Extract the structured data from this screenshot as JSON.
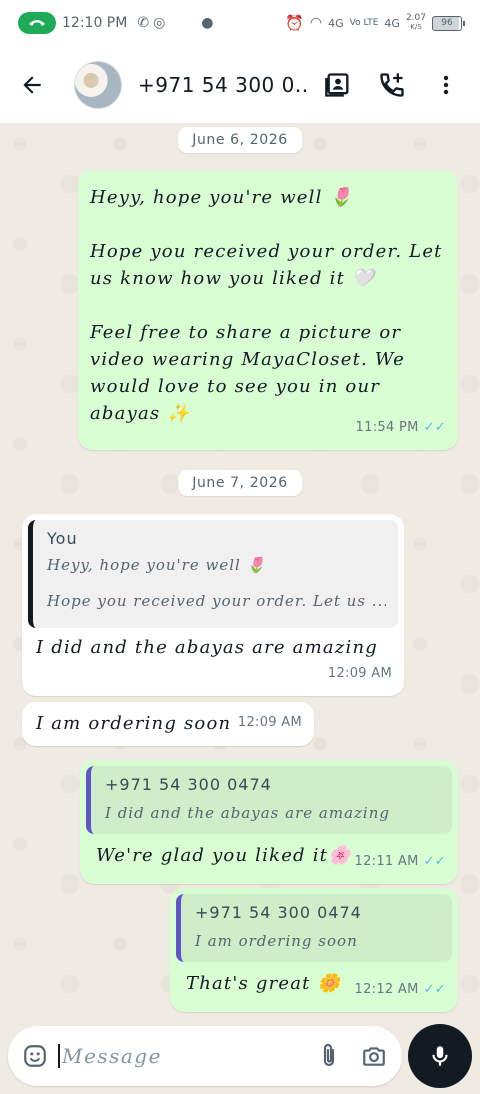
{
  "status_bar": {
    "time": "12:10 PM",
    "net_speed": "2.07",
    "net_unit": "K/S",
    "battery": "96",
    "signal1": "4G",
    "signal2": "Vo LTE",
    "signal3": "4G"
  },
  "header": {
    "contact_name": "+971 54 300 0...",
    "icons": [
      "back-arrow-icon",
      "contact-card-icon",
      "add-call-icon",
      "more-vert-icon"
    ]
  },
  "chat": {
    "date1": "June 6, 2026",
    "msg1": {
      "text": "Heyy, hope you're well 🌷\n\nHope you received your order. Let us know how you liked it 🤍\n\nFeel free to share a picture or video wearing MayaCloset. We would love to see you in our abayas ✨",
      "time": "11:54 PM"
    },
    "date2": "June 7, 2026",
    "msg2": {
      "quote_author": "You",
      "quote_line1": "Heyy, hope you're well 🌷",
      "quote_line2": "Hope you received your order. Let us ...",
      "text": "I did and the abayas are amazing",
      "time": "12:09 AM"
    },
    "msg3": {
      "text": "I am ordering soon",
      "time": "12:09 AM"
    },
    "msg4": {
      "quote_author": "+971 54 300 0474",
      "quote_text": "I did and the abayas are amazing",
      "text": "We're glad you liked it🌸",
      "time": "12:11 AM"
    },
    "msg5": {
      "quote_author": "+971 54 300 0474",
      "quote_text": "I am ordering soon",
      "text": "That's great 🌼",
      "time": "12:12 AM"
    }
  },
  "input": {
    "placeholder": "Message"
  },
  "colors": {
    "outgoing_bubble": "#d9fdd3",
    "incoming_bubble": "#ffffff",
    "read_ticks": "#53bdeb",
    "call_pill": "#1faa59",
    "quote_bar_outgoing": "#5f55c9"
  }
}
